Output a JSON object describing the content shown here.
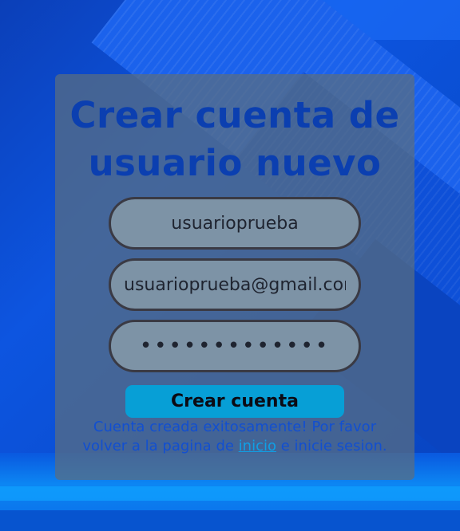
{
  "form": {
    "title_line1": "Crear cuenta de",
    "title_line2": "usuario nuevo",
    "username_value": "usuarioprueba",
    "email_value": "usuarioprueba@gmail.com",
    "password_value": "aaaaaaaaaaaaa",
    "submit_label": "Crear cuenta"
  },
  "message": {
    "line1": "Cuenta creada exitosamente! Por favor",
    "line2_prefix": "volver a la pagina de",
    "link_label": "inicio",
    "line2_suffix": "e inicie sesion."
  },
  "colors": {
    "title": "#0b3fb0",
    "button": "#079fd6",
    "message": "#124fd0",
    "link": "#0fa0e6"
  }
}
